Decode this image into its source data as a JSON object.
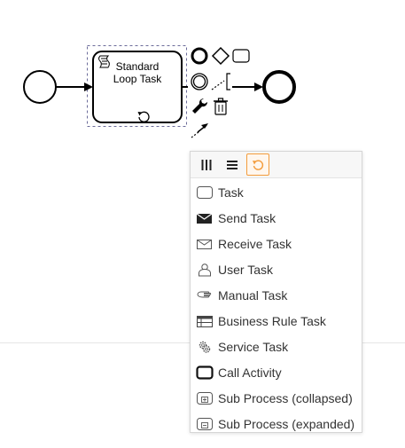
{
  "diagram": {
    "task": {
      "label_line1": "Standard",
      "label_line2": "Loop Task",
      "marker": "loop-marker-icon"
    },
    "start_event": "start-event",
    "end_event": "end-event"
  },
  "context_pad": {
    "entries": [
      {
        "name": "append-end-event",
        "icon": "thick-circle-icon"
      },
      {
        "name": "append-gateway",
        "icon": "diamond-icon"
      },
      {
        "name": "append-task",
        "icon": "rounded-rect-icon"
      },
      {
        "name": "append-intermediate-event",
        "icon": "double-circle-icon"
      },
      {
        "name": "append-text-annotation",
        "icon": "annotation-icon"
      },
      {
        "name": "replace",
        "icon": "wrench-icon"
      },
      {
        "name": "delete",
        "icon": "trash-icon"
      },
      {
        "name": "connect",
        "icon": "connect-arrow-icon"
      }
    ]
  },
  "popup": {
    "header_buttons": [
      {
        "name": "parallel-multi-instance",
        "icon": "parallel-mi-icon",
        "active": false
      },
      {
        "name": "sequential-multi-instance",
        "icon": "sequential-mi-icon",
        "active": false
      },
      {
        "name": "loop",
        "icon": "loop-icon",
        "active": true
      }
    ],
    "items": [
      {
        "label": "Task",
        "icon": "task-icon"
      },
      {
        "label": "Send Task",
        "icon": "send-task-icon"
      },
      {
        "label": "Receive Task",
        "icon": "receive-task-icon"
      },
      {
        "label": "User Task",
        "icon": "user-task-icon"
      },
      {
        "label": "Manual Task",
        "icon": "manual-task-icon"
      },
      {
        "label": "Business Rule Task",
        "icon": "business-rule-task-icon"
      },
      {
        "label": "Service Task",
        "icon": "service-task-icon"
      },
      {
        "label": "Call Activity",
        "icon": "call-activity-icon"
      },
      {
        "label": "Sub Process (collapsed)",
        "icon": "subprocess-collapsed-icon"
      },
      {
        "label": "Sub Process (expanded)",
        "icon": "subprocess-expanded-icon"
      }
    ],
    "accent_color": "#f39c3c"
  }
}
